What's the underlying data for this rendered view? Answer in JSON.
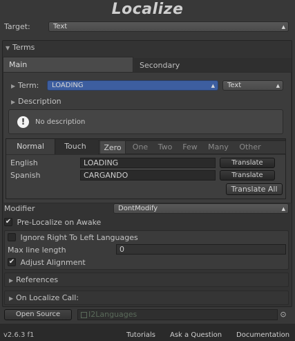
{
  "title": "Localize",
  "target": {
    "label": "Target:",
    "value": "Text"
  },
  "terms": {
    "foldout_label": "Terms",
    "tabs": [
      "Main",
      "Secondary"
    ],
    "term": {
      "label": "Term:",
      "value": "LOADING",
      "type_value": "Text"
    },
    "description": {
      "label": "Description",
      "text": "No description"
    },
    "mode_tabs": [
      "Normal",
      "Touch"
    ],
    "plural_tabs": [
      "Zero",
      "One",
      "Two",
      "Few",
      "Many",
      "Other"
    ],
    "languages": [
      {
        "name": "English",
        "value": "LOADING",
        "button": "Translate"
      },
      {
        "name": "Spanish",
        "value": "CARGANDO",
        "button": "Translate"
      }
    ],
    "translate_all": "Translate All"
  },
  "modifier": {
    "label": "Modifier",
    "value": "DontModify"
  },
  "pre_localize": {
    "label": "Pre-Localize on Awake",
    "checked": true
  },
  "rtl": {
    "ignore_label": "Ignore Right To Left Languages",
    "max_line_label": "Max line length",
    "max_line_value": "0",
    "adjust_label": "Adjust Alignment"
  },
  "references_label": "References",
  "on_localize_label": "On Localize Call:",
  "source": {
    "button": "Open Source",
    "field": "I2Languages"
  },
  "footer": {
    "version": "v2.6.3 f1",
    "links": [
      "Tutorials",
      "Ask a Question",
      "Documentation"
    ]
  }
}
